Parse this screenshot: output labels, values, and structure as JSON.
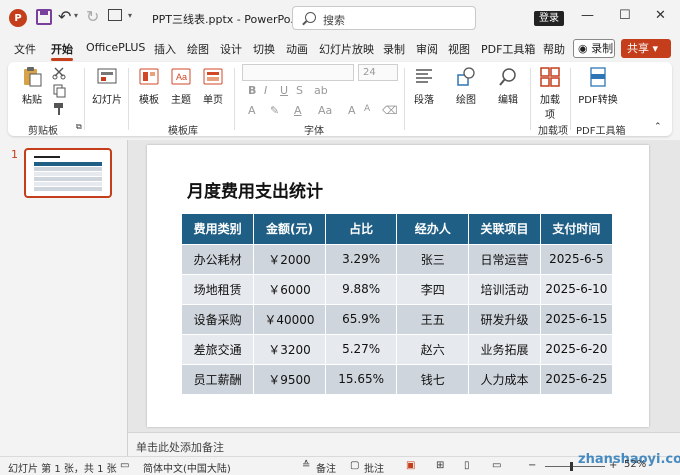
{
  "app": {
    "logo_letter": "P",
    "doc_title": "PPT三线表.pptx - PowerPo...",
    "search_placeholder": "搜索",
    "login_label": "登录",
    "minimize": "—",
    "restore": "☐",
    "close": "✕"
  },
  "tabs": [
    "文件",
    "开始",
    "OfficePLUS",
    "插入",
    "绘图",
    "设计",
    "切换",
    "动画",
    "幻灯片放映",
    "录制",
    "审阅",
    "视图",
    "PDF工具箱",
    "帮助"
  ],
  "record_label": "◉ 录制",
  "share_label": "共享 ▾",
  "ribbon": {
    "paste_label": "粘贴",
    "clipboard_group": "剪贴板",
    "new_slide_label": "幻灯片",
    "template_label": "模板",
    "theme_label": "主题",
    "single_page_label": "单页",
    "template_group": "模板库",
    "font_size": "24",
    "font_group": "字体",
    "paragraph_label": "段落",
    "drawing_label": "绘图",
    "editing_label": "编辑",
    "addins_label": "加载项",
    "addins_group": "加载项",
    "pdf_convert_label": "PDF转换",
    "pdf_group": "PDF工具箱"
  },
  "thumbnail": {
    "number": "1"
  },
  "slide": {
    "title": "月度费用支出统计",
    "headers": [
      "费用类别",
      "金额(元)",
      "占比",
      "经办人",
      "关联项目",
      "支付时间"
    ],
    "rows": [
      [
        "办公耗材",
        "￥2000",
        "3.29%",
        "张三",
        "日常运营",
        "2025-6-5"
      ],
      [
        "场地租赁",
        "￥6000",
        "9.88%",
        "李四",
        "培训活动",
        "2025-6-10"
      ],
      [
        "设备采购",
        "￥40000",
        "65.9%",
        "王五",
        "研发升级",
        "2025-6-15"
      ],
      [
        "差旅交通",
        "￥3200",
        "5.27%",
        "赵六",
        "业务拓展",
        "2025-6-20"
      ],
      [
        "员工薪酬",
        "￥9500",
        "15.65%",
        "钱七",
        "人力成本",
        "2025-6-25"
      ]
    ],
    "header_color": "#1f5f85",
    "row_color_odd": "#cfd5dc",
    "row_color_even": "#e6e9ed"
  },
  "notes": {
    "placeholder": "单击此处添加备注"
  },
  "status": {
    "slide_info": "幻灯片 第 1 张，共 1 张",
    "language": "简体中文(中国大陆)",
    "notes_label": "备注",
    "comments_label": "批注",
    "zoom": "52%"
  },
  "watermark": "zhanshaoyi.com"
}
